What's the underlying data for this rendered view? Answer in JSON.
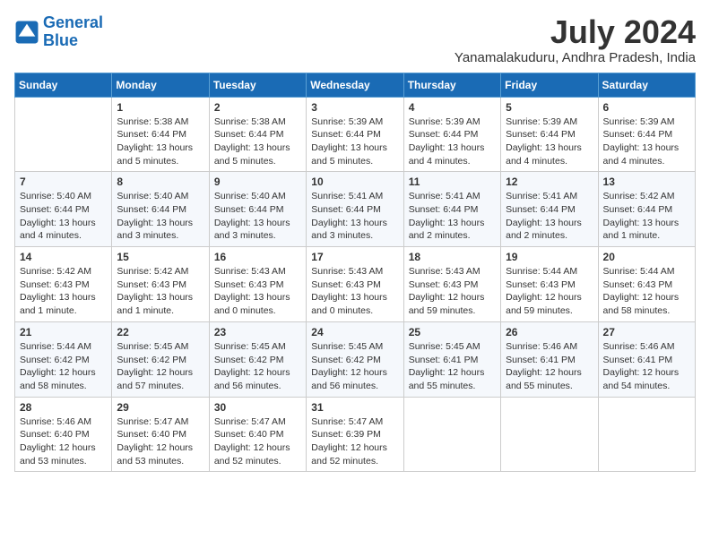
{
  "logo": {
    "line1": "General",
    "line2": "Blue"
  },
  "title": "July 2024",
  "location": "Yanamalakuduru, Andhra Pradesh, India",
  "days_of_week": [
    "Sunday",
    "Monday",
    "Tuesday",
    "Wednesday",
    "Thursday",
    "Friday",
    "Saturday"
  ],
  "weeks": [
    [
      {
        "day": "",
        "info": ""
      },
      {
        "day": "1",
        "info": "Sunrise: 5:38 AM\nSunset: 6:44 PM\nDaylight: 13 hours\nand 5 minutes."
      },
      {
        "day": "2",
        "info": "Sunrise: 5:38 AM\nSunset: 6:44 PM\nDaylight: 13 hours\nand 5 minutes."
      },
      {
        "day": "3",
        "info": "Sunrise: 5:39 AM\nSunset: 6:44 PM\nDaylight: 13 hours\nand 5 minutes."
      },
      {
        "day": "4",
        "info": "Sunrise: 5:39 AM\nSunset: 6:44 PM\nDaylight: 13 hours\nand 4 minutes."
      },
      {
        "day": "5",
        "info": "Sunrise: 5:39 AM\nSunset: 6:44 PM\nDaylight: 13 hours\nand 4 minutes."
      },
      {
        "day": "6",
        "info": "Sunrise: 5:39 AM\nSunset: 6:44 PM\nDaylight: 13 hours\nand 4 minutes."
      }
    ],
    [
      {
        "day": "7",
        "info": "Sunrise: 5:40 AM\nSunset: 6:44 PM\nDaylight: 13 hours\nand 4 minutes."
      },
      {
        "day": "8",
        "info": "Sunrise: 5:40 AM\nSunset: 6:44 PM\nDaylight: 13 hours\nand 3 minutes."
      },
      {
        "day": "9",
        "info": "Sunrise: 5:40 AM\nSunset: 6:44 PM\nDaylight: 13 hours\nand 3 minutes."
      },
      {
        "day": "10",
        "info": "Sunrise: 5:41 AM\nSunset: 6:44 PM\nDaylight: 13 hours\nand 3 minutes."
      },
      {
        "day": "11",
        "info": "Sunrise: 5:41 AM\nSunset: 6:44 PM\nDaylight: 13 hours\nand 2 minutes."
      },
      {
        "day": "12",
        "info": "Sunrise: 5:41 AM\nSunset: 6:44 PM\nDaylight: 13 hours\nand 2 minutes."
      },
      {
        "day": "13",
        "info": "Sunrise: 5:42 AM\nSunset: 6:44 PM\nDaylight: 13 hours\nand 1 minute."
      }
    ],
    [
      {
        "day": "14",
        "info": "Sunrise: 5:42 AM\nSunset: 6:43 PM\nDaylight: 13 hours\nand 1 minute."
      },
      {
        "day": "15",
        "info": "Sunrise: 5:42 AM\nSunset: 6:43 PM\nDaylight: 13 hours\nand 1 minute."
      },
      {
        "day": "16",
        "info": "Sunrise: 5:43 AM\nSunset: 6:43 PM\nDaylight: 13 hours\nand 0 minutes."
      },
      {
        "day": "17",
        "info": "Sunrise: 5:43 AM\nSunset: 6:43 PM\nDaylight: 13 hours\nand 0 minutes."
      },
      {
        "day": "18",
        "info": "Sunrise: 5:43 AM\nSunset: 6:43 PM\nDaylight: 12 hours\nand 59 minutes."
      },
      {
        "day": "19",
        "info": "Sunrise: 5:44 AM\nSunset: 6:43 PM\nDaylight: 12 hours\nand 59 minutes."
      },
      {
        "day": "20",
        "info": "Sunrise: 5:44 AM\nSunset: 6:43 PM\nDaylight: 12 hours\nand 58 minutes."
      }
    ],
    [
      {
        "day": "21",
        "info": "Sunrise: 5:44 AM\nSunset: 6:42 PM\nDaylight: 12 hours\nand 58 minutes."
      },
      {
        "day": "22",
        "info": "Sunrise: 5:45 AM\nSunset: 6:42 PM\nDaylight: 12 hours\nand 57 minutes."
      },
      {
        "day": "23",
        "info": "Sunrise: 5:45 AM\nSunset: 6:42 PM\nDaylight: 12 hours\nand 56 minutes."
      },
      {
        "day": "24",
        "info": "Sunrise: 5:45 AM\nSunset: 6:42 PM\nDaylight: 12 hours\nand 56 minutes."
      },
      {
        "day": "25",
        "info": "Sunrise: 5:45 AM\nSunset: 6:41 PM\nDaylight: 12 hours\nand 55 minutes."
      },
      {
        "day": "26",
        "info": "Sunrise: 5:46 AM\nSunset: 6:41 PM\nDaylight: 12 hours\nand 55 minutes."
      },
      {
        "day": "27",
        "info": "Sunrise: 5:46 AM\nSunset: 6:41 PM\nDaylight: 12 hours\nand 54 minutes."
      }
    ],
    [
      {
        "day": "28",
        "info": "Sunrise: 5:46 AM\nSunset: 6:40 PM\nDaylight: 12 hours\nand 53 minutes."
      },
      {
        "day": "29",
        "info": "Sunrise: 5:47 AM\nSunset: 6:40 PM\nDaylight: 12 hours\nand 53 minutes."
      },
      {
        "day": "30",
        "info": "Sunrise: 5:47 AM\nSunset: 6:40 PM\nDaylight: 12 hours\nand 52 minutes."
      },
      {
        "day": "31",
        "info": "Sunrise: 5:47 AM\nSunset: 6:39 PM\nDaylight: 12 hours\nand 52 minutes."
      },
      {
        "day": "",
        "info": ""
      },
      {
        "day": "",
        "info": ""
      },
      {
        "day": "",
        "info": ""
      }
    ]
  ]
}
